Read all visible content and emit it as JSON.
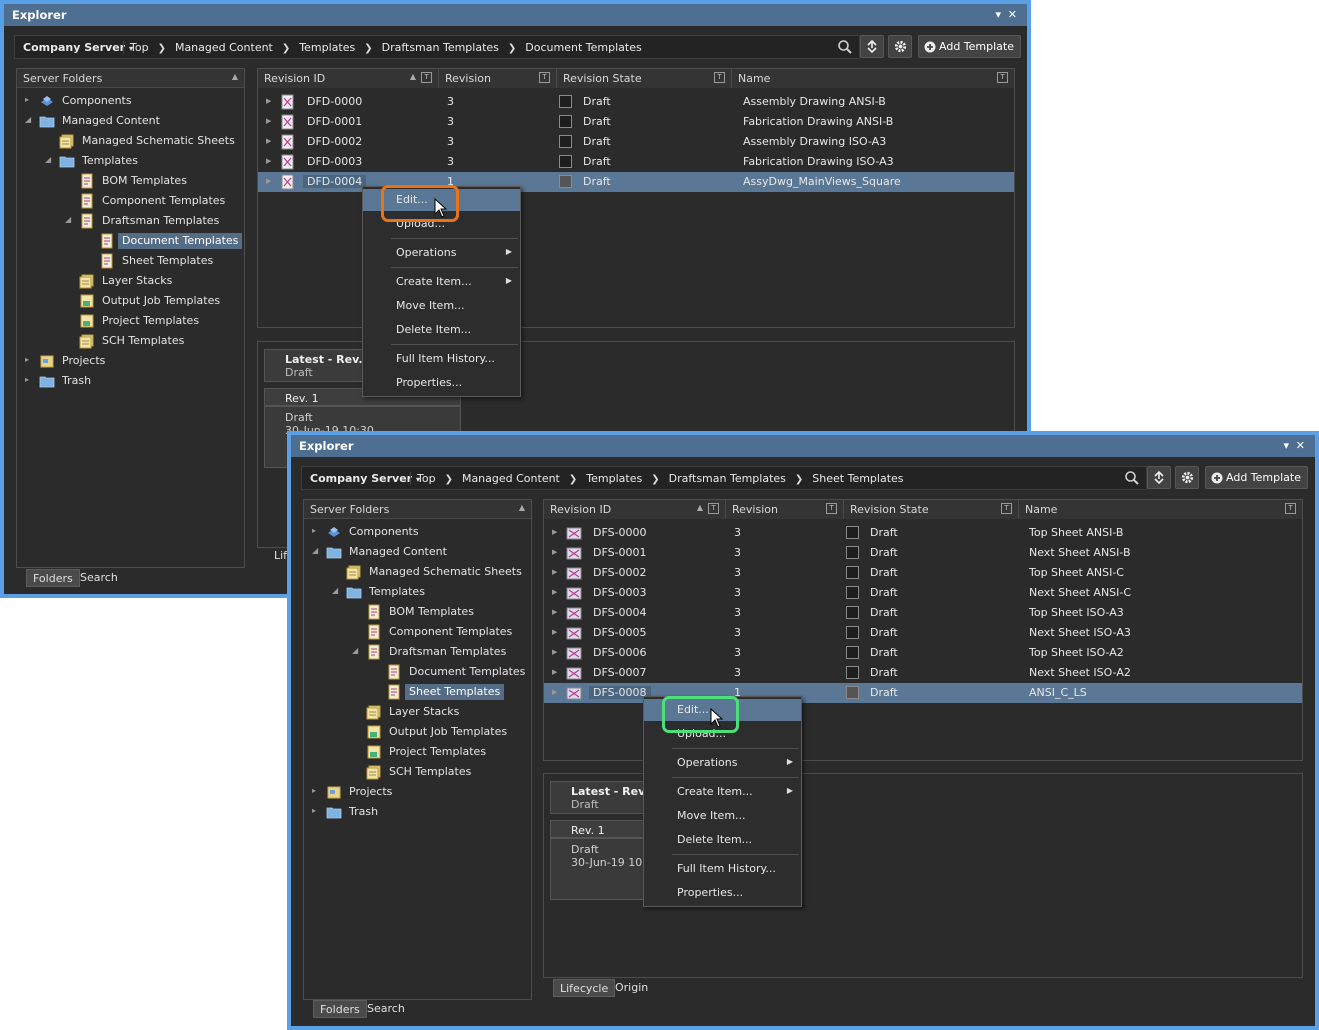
{
  "back_window": {
    "title": "Explorer",
    "server": "Company Server",
    "breadcrumbs": [
      "Top",
      "Managed Content",
      "Templates",
      "Draftsman Templates",
      "Document Templates"
    ],
    "add_button": "Add Template",
    "folders_header": "Server Folders",
    "tree": [
      {
        "label": "Components",
        "icon": "components-icon"
      },
      {
        "label": "Managed Content",
        "icon": "folder-icon"
      },
      {
        "label": "Managed Schematic Sheets",
        "icon": "schematic-sheets-icon"
      },
      {
        "label": "Templates",
        "icon": "folder-icon"
      },
      {
        "label": "BOM Templates",
        "icon": "bom-template-icon"
      },
      {
        "label": "Component Templates",
        "icon": "component-template-icon"
      },
      {
        "label": "Draftsman Templates",
        "icon": "draftsman-template-icon"
      },
      {
        "label": "Document Templates",
        "icon": "document-template-icon"
      },
      {
        "label": "Sheet Templates",
        "icon": "sheet-template-icon"
      },
      {
        "label": "Layer Stacks",
        "icon": "layer-stack-icon"
      },
      {
        "label": "Output Job Templates",
        "icon": "output-job-icon"
      },
      {
        "label": "Project Templates",
        "icon": "project-template-icon"
      },
      {
        "label": "SCH Templates",
        "icon": "sch-template-icon"
      },
      {
        "label": "Projects",
        "icon": "projects-icon"
      },
      {
        "label": "Trash",
        "icon": "folder-icon"
      }
    ],
    "columns": [
      "Revision ID",
      "Revision",
      "Revision State",
      "Name"
    ],
    "rows": [
      {
        "id": "DFD-0000",
        "rev": "3",
        "state": "Draft",
        "name": "Assembly Drawing ANSI-B"
      },
      {
        "id": "DFD-0001",
        "rev": "3",
        "state": "Draft",
        "name": "Fabrication Drawing ANSI-B"
      },
      {
        "id": "DFD-0002",
        "rev": "3",
        "state": "Draft",
        "name": "Assembly Drawing ISO-A3"
      },
      {
        "id": "DFD-0003",
        "rev": "3",
        "state": "Draft",
        "name": "Fabrication Drawing ISO-A3"
      },
      {
        "id": "DFD-0004",
        "rev": "1",
        "state": "Draft",
        "name": "AssyDwg_MainViews_Square"
      }
    ],
    "context_menu": [
      "Edit...",
      "Upload...",
      "Operations",
      "Create Item...",
      "Move Item...",
      "Delete Item...",
      "Full Item History...",
      "Properties..."
    ],
    "lifecycle": {
      "latest": "Latest - Rev.  1",
      "latest_state": "Draft",
      "rev": "Rev. 1",
      "rev_state": "Draft",
      "rev_date_fragment": "30-Jun-19 10:30",
      "tab_fragment": "Life"
    },
    "tabs": [
      "Folders",
      "Search"
    ],
    "highlight_color": "#e8741a"
  },
  "front_window": {
    "title": "Explorer",
    "server": "Company Server",
    "breadcrumbs": [
      "Top",
      "Managed Content",
      "Templates",
      "Draftsman Templates",
      "Sheet Templates"
    ],
    "add_button": "Add Template",
    "folders_header": "Server Folders",
    "tree": [
      {
        "label": "Components",
        "icon": "components-icon"
      },
      {
        "label": "Managed Content",
        "icon": "folder-icon"
      },
      {
        "label": "Managed Schematic Sheets",
        "icon": "schematic-sheets-icon"
      },
      {
        "label": "Templates",
        "icon": "folder-icon"
      },
      {
        "label": "BOM Templates",
        "icon": "bom-template-icon"
      },
      {
        "label": "Component Templates",
        "icon": "component-template-icon"
      },
      {
        "label": "Draftsman Templates",
        "icon": "draftsman-template-icon"
      },
      {
        "label": "Document Templates",
        "icon": "document-template-icon"
      },
      {
        "label": "Sheet Templates",
        "icon": "sheet-template-icon"
      },
      {
        "label": "Layer Stacks",
        "icon": "layer-stack-icon"
      },
      {
        "label": "Output Job Templates",
        "icon": "output-job-icon"
      },
      {
        "label": "Project Templates",
        "icon": "project-template-icon"
      },
      {
        "label": "SCH Templates",
        "icon": "sch-template-icon"
      },
      {
        "label": "Projects",
        "icon": "projects-icon"
      },
      {
        "label": "Trash",
        "icon": "folder-icon"
      }
    ],
    "columns": [
      "Revision ID",
      "Revision",
      "Revision State",
      "Name"
    ],
    "rows": [
      {
        "id": "DFS-0000",
        "rev": "3",
        "state": "Draft",
        "name": "Top Sheet ANSI-B"
      },
      {
        "id": "DFS-0001",
        "rev": "3",
        "state": "Draft",
        "name": "Next Sheet ANSI-B"
      },
      {
        "id": "DFS-0002",
        "rev": "3",
        "state": "Draft",
        "name": "Top Sheet ANSI-C"
      },
      {
        "id": "DFS-0003",
        "rev": "3",
        "state": "Draft",
        "name": "Next Sheet ANSI-C"
      },
      {
        "id": "DFS-0004",
        "rev": "3",
        "state": "Draft",
        "name": "Top Sheet ISO-A3"
      },
      {
        "id": "DFS-0005",
        "rev": "3",
        "state": "Draft",
        "name": "Next Sheet ISO-A3"
      },
      {
        "id": "DFS-0006",
        "rev": "3",
        "state": "Draft",
        "name": "Top Sheet ISO-A2"
      },
      {
        "id": "DFS-0007",
        "rev": "3",
        "state": "Draft",
        "name": "Next Sheet ISO-A2"
      },
      {
        "id": "DFS-0008",
        "rev": "1",
        "state": "Draft",
        "name": "ANSI_C_LS"
      }
    ],
    "context_menu": [
      "Edit...",
      "Upload...",
      "Operations",
      "Create Item...",
      "Move Item...",
      "Delete Item...",
      "Full Item History...",
      "Properties..."
    ],
    "lifecycle": {
      "latest": "Latest - Rev.  1",
      "latest_state": "Draft",
      "rev": "Rev. 1",
      "rev_state": "Draft",
      "rev_date": "30-Jun-19 10:3"
    },
    "lifecycle_tabs": [
      "Lifecycle",
      "Origin"
    ],
    "tabs": [
      "Folders",
      "Search"
    ],
    "highlight_color": "#4be07a"
  },
  "colors": {
    "window_border": "#5aa0e6",
    "titlebar": "#4e6e92",
    "selection": "#5a7795",
    "background": "#2b2b2b"
  }
}
